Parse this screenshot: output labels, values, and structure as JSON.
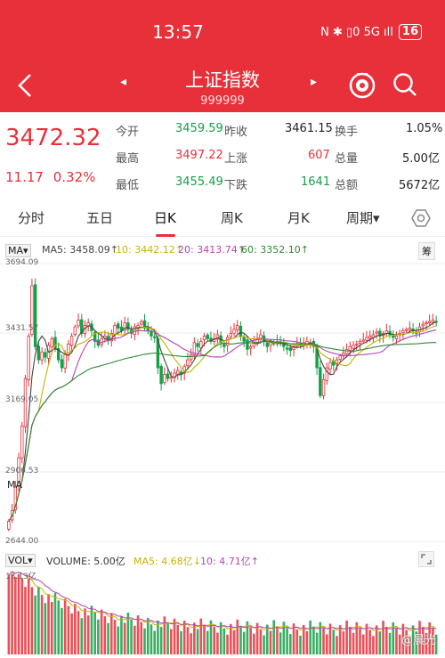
{
  "status": {
    "time": "13:57",
    "icons": "N ✱ ▯0 5G ıll",
    "battery": "16"
  },
  "header": {
    "title": "上证指数",
    "code": "999999",
    "prev": "◂",
    "next": "▸"
  },
  "quote": {
    "price": "3472.32",
    "change": "11.17",
    "change_pct": "0.32%",
    "open_label": "今开",
    "open": "3459.59",
    "prev_close_label": "昨收",
    "prev_close": "3461.15",
    "turnover_label": "换手",
    "turnover": "1.05%",
    "high_label": "最高",
    "high": "3497.22",
    "up_label": "上涨",
    "up": "607",
    "volume_label": "总量",
    "volume": "5.00亿",
    "low_label": "最低",
    "low": "3455.49",
    "down_label": "下跌",
    "down": "1641",
    "amount_label": "总额",
    "amount": "5672亿"
  },
  "tabs": [
    "分时",
    "五日",
    "日K",
    "周K",
    "月K",
    "周期▾"
  ],
  "ma_bar": {
    "selector": "MA",
    "ma5": "MA5: 3458.09↑",
    "ma10": "10: 3442.12↑",
    "ma20": "20: 3413.74↑",
    "ma60": "60: 3352.10↑",
    "chou": "筹"
  },
  "chart": {
    "y_labels": [
      "3694.09",
      "3431.57",
      "3169.05",
      "2906.53",
      "2644.00"
    ],
    "y_max": 3694.09,
    "y_min": 2644.0,
    "ma_tag": "MA",
    "colors": {
      "up": "#e8303a",
      "down": "#14a046",
      "ma5": "#444444",
      "ma10": "#c8b400",
      "ma20": "#b544b5",
      "ma60": "#2e8b2e"
    }
  },
  "volume": {
    "selector": "VOL",
    "vol": "VOLUME: 5.00亿",
    "ma5": "MA5: 4.68亿↓",
    "ma10": "10: 4.71亿↑",
    "max_label": "13.13亿",
    "y_max": 13.13
  },
  "chart_data": {
    "type": "candlestick",
    "close_series": [
      2720,
      2760,
      2850,
      2960,
      3080,
      3260,
      3420,
      3610,
      3380,
      3330,
      3360,
      3340,
      3385,
      3410,
      3370,
      3330,
      3300,
      3350,
      3390,
      3420,
      3455,
      3480,
      3430,
      3460,
      3470,
      3440,
      3400,
      3385,
      3410,
      3420,
      3405,
      3430,
      3460,
      3450,
      3440,
      3470,
      3445,
      3430,
      3455,
      3460,
      3475,
      3450,
      3440,
      3420,
      3415,
      3300,
      3240,
      3275,
      3260,
      3265,
      3280,
      3290,
      3275,
      3305,
      3330,
      3350,
      3395,
      3380,
      3400,
      3420,
      3410,
      3400,
      3410,
      3425,
      3395,
      3380,
      3415,
      3430,
      3445,
      3460,
      3420,
      3400,
      3370,
      3380,
      3395,
      3410,
      3425,
      3400,
      3380,
      3395,
      3390,
      3400,
      3395,
      3380,
      3370,
      3365,
      3380,
      3390,
      3385,
      3395,
      3400,
      3395,
      3380,
      3300,
      3195,
      3255,
      3300,
      3320,
      3310,
      3330,
      3345,
      3355,
      3370,
      3380,
      3385,
      3390,
      3400,
      3405,
      3415,
      3420,
      3425,
      3435,
      3420,
      3430,
      3440,
      3425,
      3415,
      3420,
      3430,
      3440,
      3445,
      3450,
      3440,
      3430,
      3455,
      3465,
      3470,
      3475,
      3480,
      3472
    ]
  }
}
